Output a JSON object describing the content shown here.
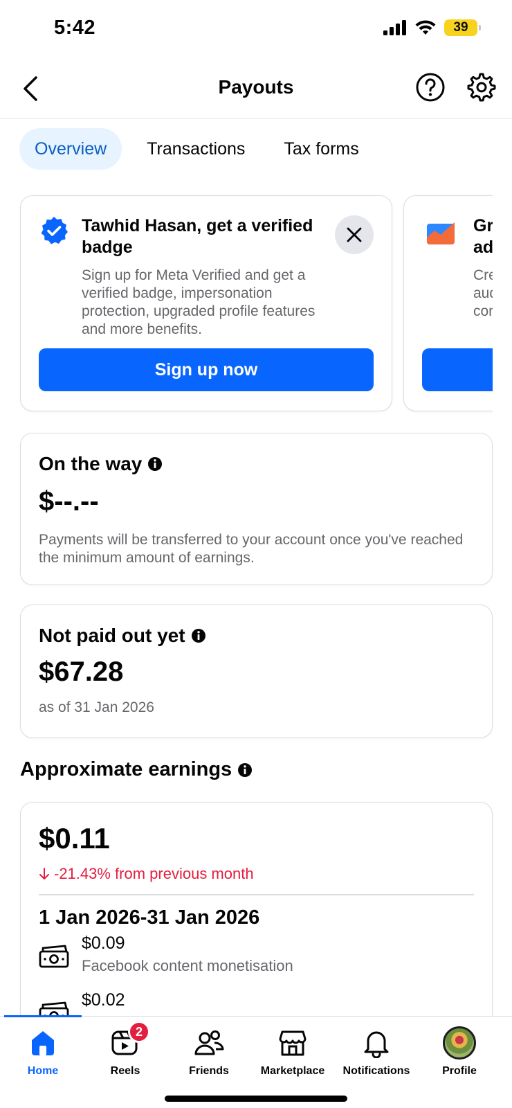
{
  "status_bar": {
    "time": "5:42",
    "battery": "39",
    "icons": [
      "signal-icon",
      "wifi-icon",
      "battery-icon"
    ]
  },
  "header": {
    "title": "Payouts",
    "icons": [
      "back-chevron-icon",
      "help-icon",
      "settings-icon"
    ]
  },
  "tabs": [
    {
      "label": "Overview",
      "active": true
    },
    {
      "label": "Transactions",
      "active": false
    },
    {
      "label": "Tax forms",
      "active": false
    }
  ],
  "promo": {
    "title": "Tawhid Hasan, get a verified badge",
    "description": "Sign up for Meta Verified and get a verified badge, impersonation protection, upgraded profile features and more benefits.",
    "button": "Sign up now",
    "second_card_title": "Gr\nad",
    "second_card_desc": "Cre\naud\ncon"
  },
  "on_the_way": {
    "heading": "On the way",
    "amount": "$--.--",
    "note": "Payments will be transferred to your account once you've reached the minimum amount of earnings."
  },
  "not_paid": {
    "heading": "Not paid out yet",
    "amount": "$67.28",
    "as_of": "as of 31 Jan 2026"
  },
  "earnings": {
    "heading": "Approximate earnings",
    "total": "$0.11",
    "change": "-21.43% from previous month",
    "change_color": "#e41e3f",
    "period": "1 Jan 2026-31 Jan 2026",
    "items": [
      {
        "amount": "$0.09",
        "label": "Facebook content monetisation"
      },
      {
        "amount": "$0.02",
        "label": ""
      }
    ]
  },
  "bottom_nav": [
    {
      "label": "Home",
      "icon": "home-icon",
      "active": true
    },
    {
      "label": "Reels",
      "icon": "reels-icon",
      "badge": "2"
    },
    {
      "label": "Friends",
      "icon": "friends-icon"
    },
    {
      "label": "Marketplace",
      "icon": "marketplace-icon"
    },
    {
      "label": "Notifications",
      "icon": "bell-icon"
    },
    {
      "label": "Profile",
      "icon": "avatar"
    }
  ],
  "colors": {
    "accent": "#0866ff",
    "tab_active_bg": "#e7f3ff",
    "tab_active_text": "#0a5dc2",
    "negative": "#e41e3f",
    "muted_text": "#65676b"
  }
}
